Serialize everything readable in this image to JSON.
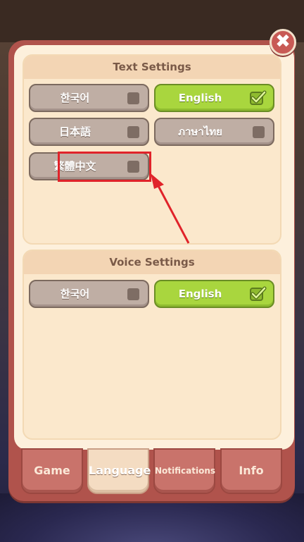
{
  "close_label": "✖",
  "text_settings": {
    "title": "Text Settings",
    "options": [
      {
        "label": "한국어",
        "selected": false
      },
      {
        "label": "English",
        "selected": true
      },
      {
        "label": "日本語",
        "selected": false
      },
      {
        "label": "ภาษาไทย",
        "selected": false
      },
      {
        "label": "繁體中文",
        "selected": false
      }
    ]
  },
  "voice_settings": {
    "title": "Voice Settings",
    "options": [
      {
        "label": "한국어",
        "selected": false
      },
      {
        "label": "English",
        "selected": true
      }
    ]
  },
  "tabs": [
    {
      "label": "Game",
      "active": false
    },
    {
      "label": "Language",
      "active": true
    },
    {
      "label": "Notifications",
      "active": false
    },
    {
      "label": "Info",
      "active": false
    }
  ],
  "colors": {
    "selected_green": "#a9d63e",
    "unselected_gray": "#bfaea4",
    "highlight_red": "#e0232a",
    "panel_red": "#b0534c"
  }
}
